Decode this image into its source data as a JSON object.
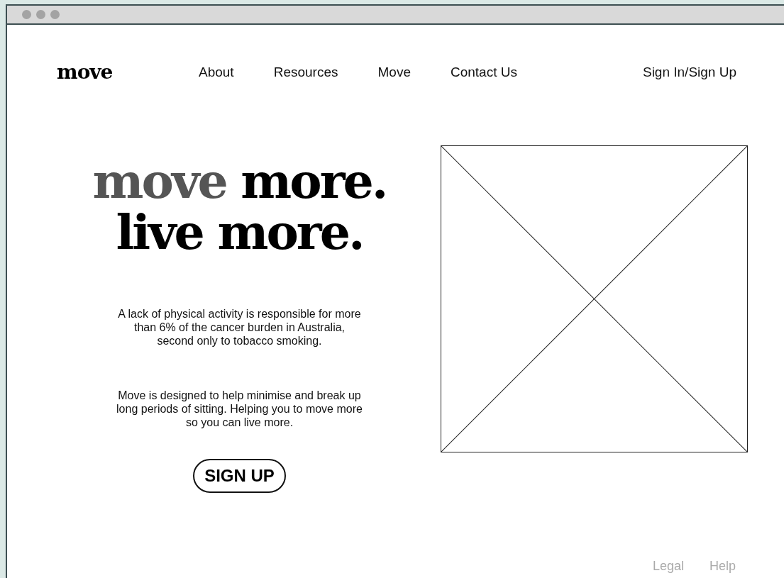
{
  "nav": {
    "logo": "move",
    "links": [
      "About",
      "Resources",
      "Move",
      "Contact Us"
    ],
    "account": "Sign In/Sign Up"
  },
  "hero": {
    "headline": [
      [
        {
          "text": "move",
          "accent": true
        },
        {
          "text": " more.",
          "accent": false
        }
      ],
      [
        {
          "text": "live more.",
          "accent": false
        }
      ]
    ],
    "paragraphs": [
      "A lack of physical activity is responsible for more than 6% of the cancer burden in Australia, second only to tobacco smoking.",
      "Move is designed to help minimise and break up long periods of sitting. Helping you to move more so you can live more."
    ],
    "button": "SIGN UP",
    "image": {
      "kind": "placeholder"
    }
  },
  "footer": {
    "links": [
      "Legal",
      "Help"
    ]
  }
}
